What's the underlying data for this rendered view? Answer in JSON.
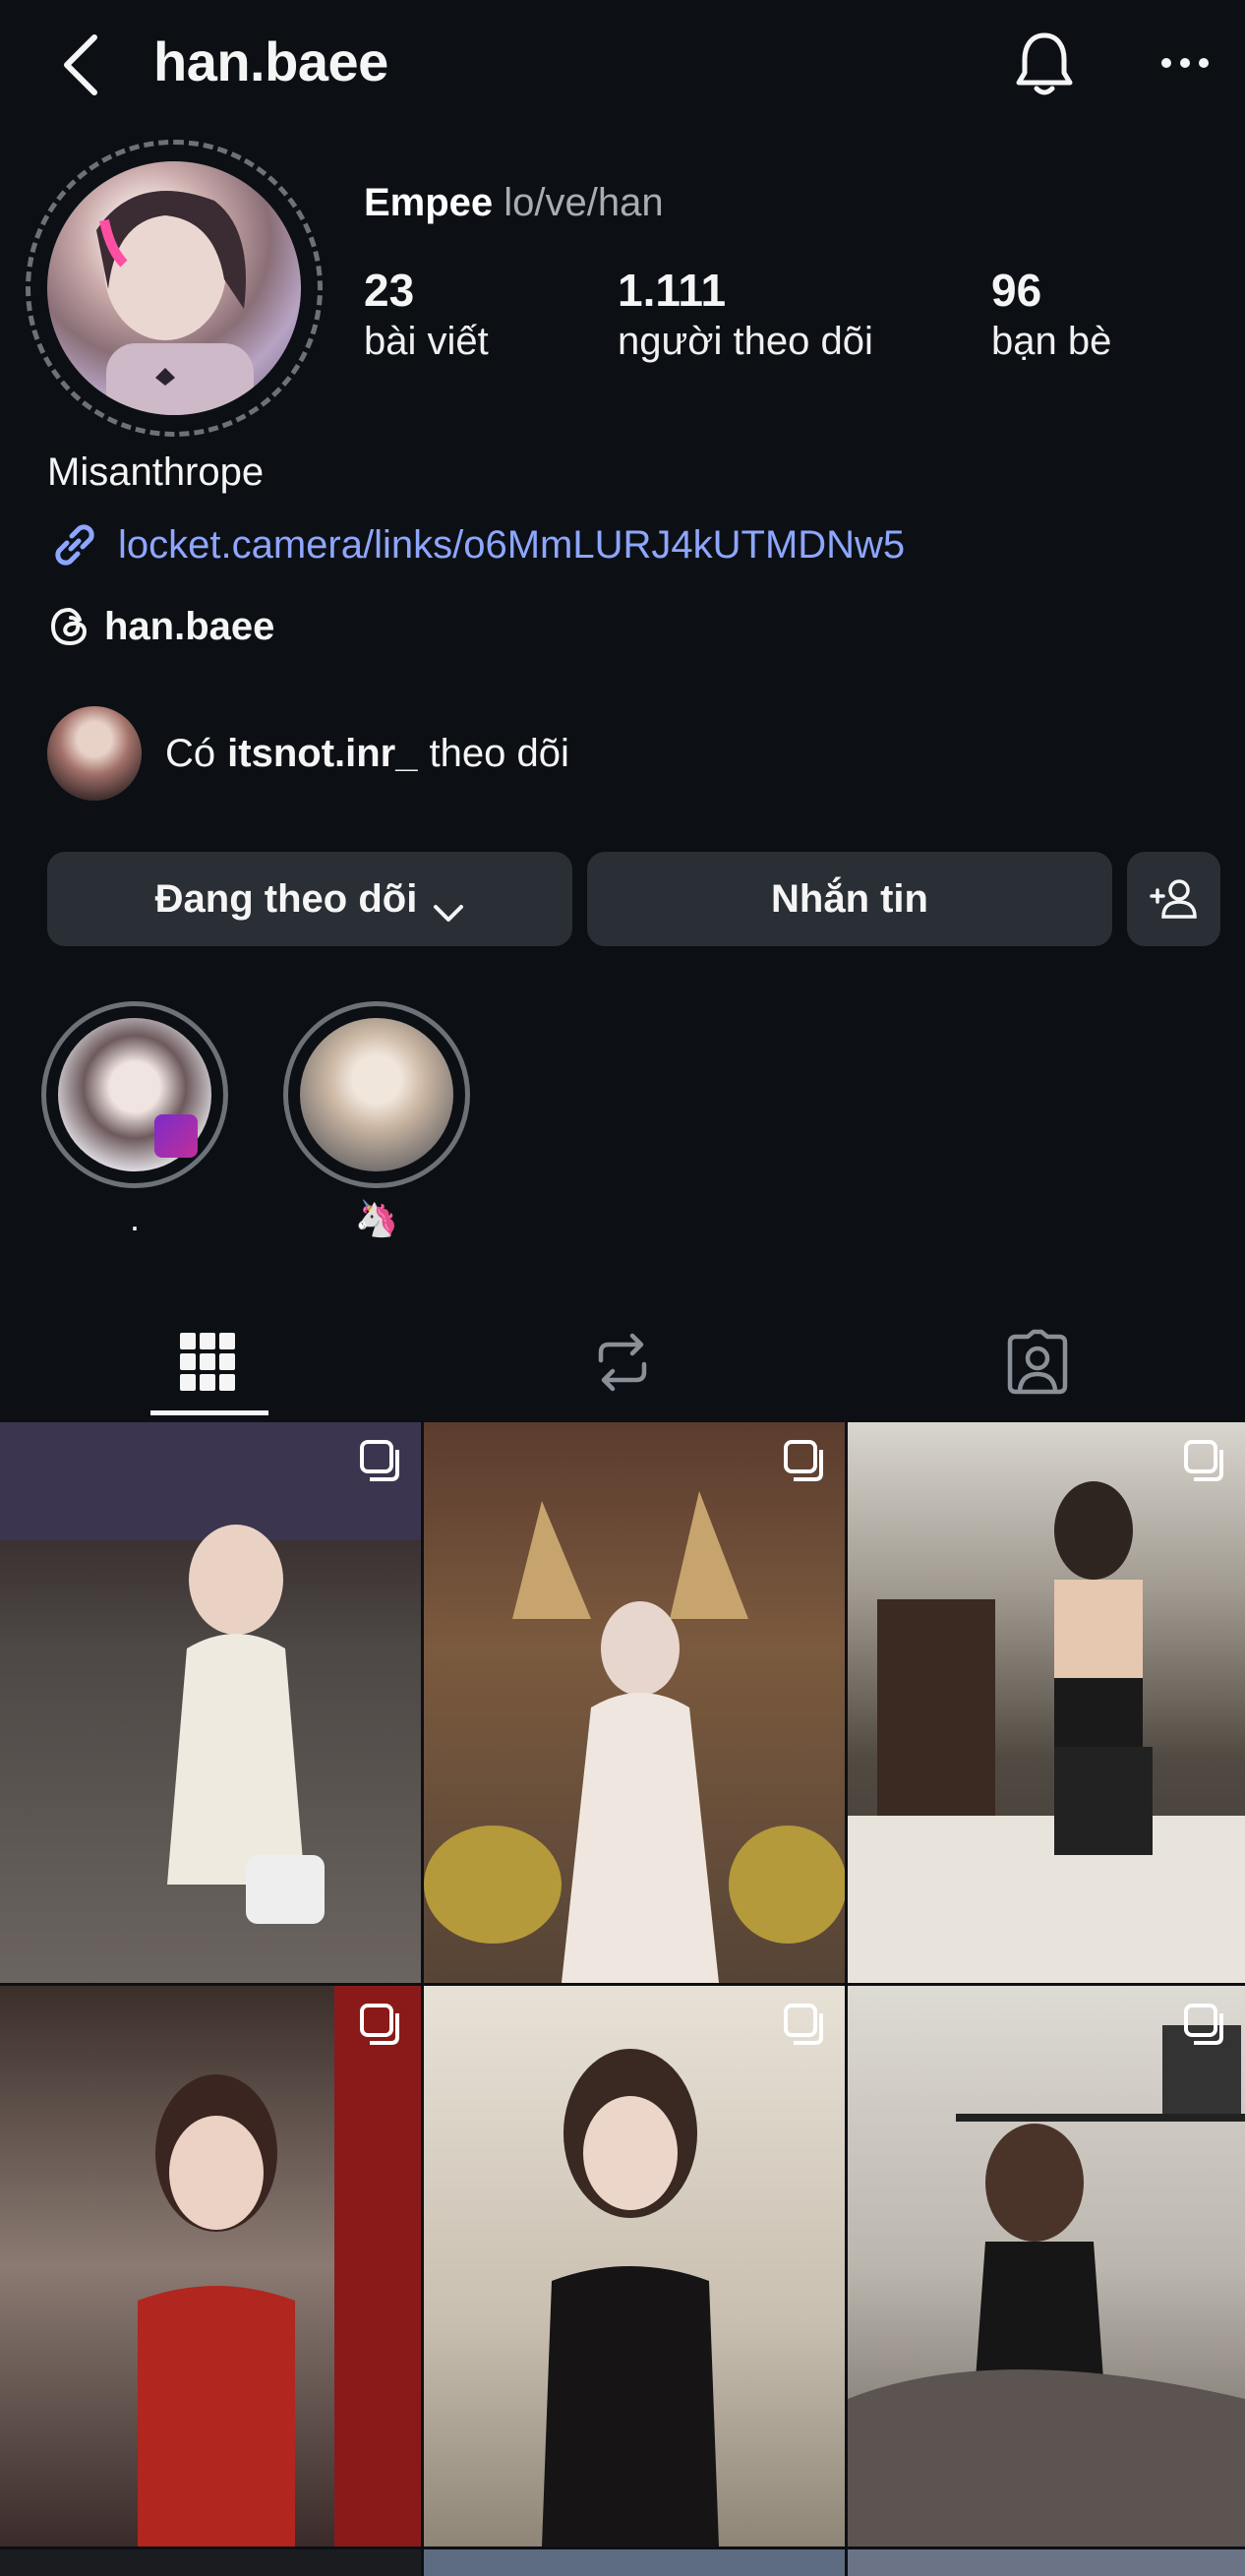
{
  "header": {
    "username": "han.baee"
  },
  "profile": {
    "display_name": "Empee",
    "pronouns": "lo/ve/han",
    "stats": [
      {
        "value": "23",
        "label": "bài viết"
      },
      {
        "value": "1.111",
        "label": "người theo dõi"
      },
      {
        "value": "96",
        "label": "bạn bè"
      }
    ],
    "bio": "Misanthrope",
    "link": "locket.camera/links/o6MmLURJ4kUTMDNw5",
    "threads_handle": "han.baee",
    "mutual": {
      "prefix": "Có",
      "user": "itsnot.inr_",
      "suffix": "theo dõi"
    }
  },
  "actions": {
    "following_label": "Đang theo dõi",
    "message_label": "Nhắn tin"
  },
  "highlights": [
    {
      "label": "."
    },
    {
      "label": "🦄"
    }
  ],
  "colors": {
    "background": "#0c1015",
    "button": "#2a2f36",
    "link": "#8ea6ff"
  },
  "tabs": [
    "grid-icon",
    "reposts-icon",
    "tagged-icon"
  ]
}
